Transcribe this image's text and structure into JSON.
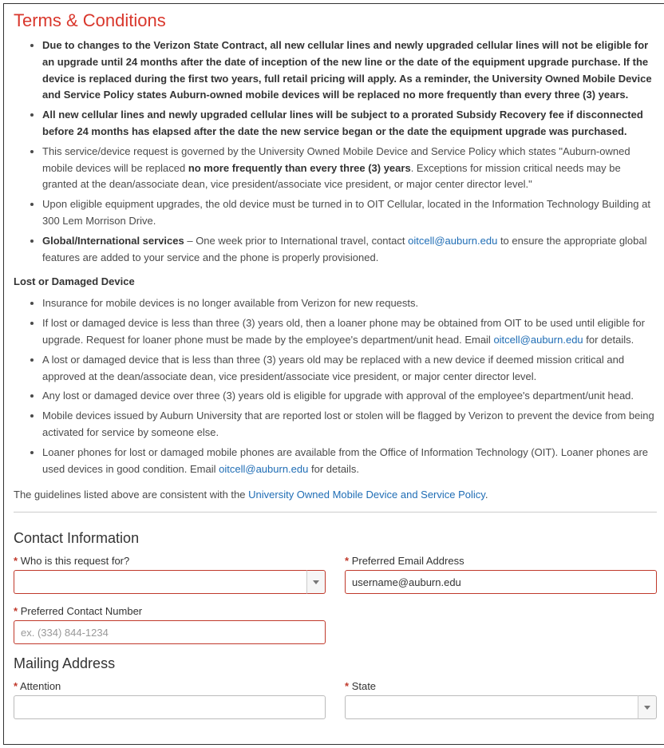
{
  "terms": {
    "heading": "Terms & Conditions",
    "items": [
      {
        "bold_full": "Due to changes to the Verizon State Contract, all new cellular lines and newly upgraded cellular lines will not be eligible for an upgrade until 24 months after the date of inception of the new line or the date of the equipment upgrade purchase. If the device is replaced during the first two years, full retail pricing will apply. As a reminder, the University Owned Mobile Device and Service Policy states Auburn-owned mobile devices will be replaced no more frequently than every three (3) years."
      },
      {
        "bold_full": "All new cellular lines and newly upgraded cellular lines will be subject to a prorated Subsidy Recovery fee if disconnected before 24 months has elapsed after the date the new service began or the date the equipment upgrade was purchased."
      },
      {
        "pre": "This service/device request is governed by the University Owned Mobile Device and Service Policy which states \"Auburn-owned mobile devices will be replaced ",
        "bold_mid": "no more frequently than every three (3) years",
        "post": ".  Exceptions for mission critical needs may be granted at the dean/associate dean, vice president/associate vice president, or major center director level.\""
      },
      {
        "text": "Upon eligible equipment upgrades, the old device must be turned in to OIT Cellular, located in the Information Technology Building at 300 Lem Morrison Drive."
      },
      {
        "bold_lead": "Global/International services",
        "mid": " – One week prior to International travel, contact ",
        "link": "oitcell@auburn.edu",
        "post": " to ensure the appropriate global features are added to your service and the phone is properly provisioned."
      }
    ]
  },
  "lost": {
    "heading": "Lost or Damaged Device",
    "items": [
      {
        "text": "Insurance for mobile devices is no longer available from Verizon for new requests."
      },
      {
        "pre": "If lost or damaged device is less than three (3) years old, then a loaner phone may be obtained from OIT to be used until eligible for upgrade.  Request for loaner phone must be made by the employee's department/unit head.  Email ",
        "link": "oitcell@auburn.edu",
        "post": " for details."
      },
      {
        "text": "A lost or damaged device that is less than three (3) years old may be replaced with a new device if deemed mission critical and approved at the dean/associate dean, vice president/associate vice president, or major center director level."
      },
      {
        "text": "Any lost or damaged device over three (3) years old is eligible for upgrade with approval of the employee's department/unit head."
      },
      {
        "text": "Mobile devices issued by Auburn University that are reported lost or stolen will be flagged by Verizon to prevent the device from being activated for service by someone else."
      },
      {
        "pre": "Loaner phones for lost or damaged mobile phones are available from the Office of Information Technology (OIT).  Loaner phones are used devices in good condition.  Email ",
        "link": "oitcell@auburn.edu",
        "post": " for details."
      }
    ]
  },
  "guidelines": {
    "pre": "The guidelines listed above are consistent with the ",
    "link": "University Owned Mobile Device and Service Policy",
    "post": "."
  },
  "contact": {
    "heading": "Contact Information",
    "who_label": "Who is this request for?",
    "email_label": "Preferred Email Address",
    "email_value": "username@auburn.edu",
    "phone_label": "Preferred Contact Number",
    "phone_placeholder": "ex. (334) 844-1234"
  },
  "mailing": {
    "heading": "Mailing Address",
    "attention_label": "Attention",
    "state_label": "State"
  },
  "asterisk": "*"
}
